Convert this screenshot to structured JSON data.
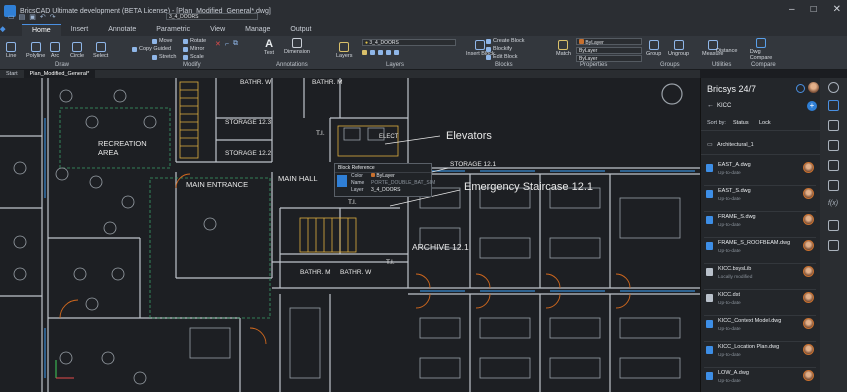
{
  "window": {
    "title": "BricsCAD Ultimate development (BETA License) - [Plan_Modified_General*.dwg]"
  },
  "quick_access": {
    "layer_name": "3_4_DOORS"
  },
  "ribbon_tabs": [
    "Home",
    "Insert",
    "Annotate",
    "Parametric",
    "View",
    "Manage",
    "Output"
  ],
  "ribbon": {
    "draw_tools": [
      "Line",
      "Polyline",
      "Arc",
      "Circle",
      "Select"
    ],
    "modify_tools": [
      "Move",
      "Rotate",
      "Copy Guided",
      "Mirror",
      "Stretch",
      "Scale"
    ],
    "annotation_tools": [
      "Text",
      "Dimension"
    ],
    "layer_dropdown": "3_4_DOORS",
    "block_tools": [
      "Insert Block",
      "Create Block",
      "Blockify",
      "Edit Block"
    ],
    "match_label": "Match",
    "bylayer": [
      "ByLayer",
      "ByLayer",
      "ByLayer"
    ],
    "group_tools": [
      "Group",
      "Ungroup"
    ],
    "utilities_tools": [
      "Measure",
      "Distance"
    ],
    "compare_tool": "Dwg Compare",
    "panels": {
      "draw": "Draw",
      "modify": "Modify",
      "annotations": "Annotations",
      "layers": "Layers",
      "layers_btn": "Layers",
      "blocks": "Blocks",
      "properties": "Properties",
      "groups": "Groups",
      "utilities": "Utilities",
      "compare": "Compare"
    }
  },
  "doc_tabs": [
    "Start",
    "Plan_Modified_General*"
  ],
  "drawing": {
    "room_labels": [
      "BATHR. W",
      "BATHR. M",
      "STORAGE 12.3",
      "STORAGE 12.2",
      "ELECT",
      "RECREATION",
      "AREA",
      "MAIN ENTRANCE",
      "MAIN HALL",
      "T.I.",
      "T.I.",
      "STORAGE 12.1",
      "ARCHIVE 12.1",
      "BATHR. M",
      "BATHR. W",
      "T.I."
    ],
    "callouts": {
      "elevators": "Elevators",
      "staircase": "Emergency Staircase 12.1"
    },
    "block_tooltip": {
      "title": "Block Reference",
      "rows": [
        {
          "key": "Color",
          "value": "ByLayer"
        },
        {
          "key": "Name",
          "value": "PORTE_DOUBLE_BAT_SIM"
        },
        {
          "key": "Layer",
          "value": "3_4_DOORS"
        }
      ]
    }
  },
  "panel": {
    "title": "Bricsys 24/7",
    "breadcrumb": "KICC",
    "sort_by": "Sort by:",
    "sort_options": [
      "Status",
      "Lock"
    ],
    "folder": "Architectural_1",
    "files": [
      {
        "name": "EAST_A.dwg",
        "status": "Up-to-date",
        "kind": "dwg"
      },
      {
        "name": "EAST_S.dwg",
        "status": "Up-to-date",
        "kind": "dwg"
      },
      {
        "name": "FRAME_S.dwg",
        "status": "Up-to-date",
        "kind": "dwg"
      },
      {
        "name": "FRAME_S_ROOFBEAM.dwg",
        "status": "Up-to-date",
        "kind": "dwg"
      },
      {
        "name": "KICC.bsysLib",
        "status": "Locally modified",
        "kind": "lib"
      },
      {
        "name": "KICC.dst",
        "status": "Up-to-date",
        "kind": "lib"
      },
      {
        "name": "KICC_Context Model.dwg",
        "status": "Up-to-date",
        "kind": "dwg"
      },
      {
        "name": "KICC_Location Plan.dwg",
        "status": "Up-to-date",
        "kind": "dwg"
      },
      {
        "name": "LOW_A.dwg",
        "status": "Up-to-date",
        "kind": "dwg"
      }
    ]
  },
  "colors": {
    "accent": "#2f7fd6",
    "canvas": "#1d1f23",
    "wall": "#bfc4ca",
    "door": "#d2691e",
    "stair": "#e0b040",
    "panel": "#23262a"
  }
}
